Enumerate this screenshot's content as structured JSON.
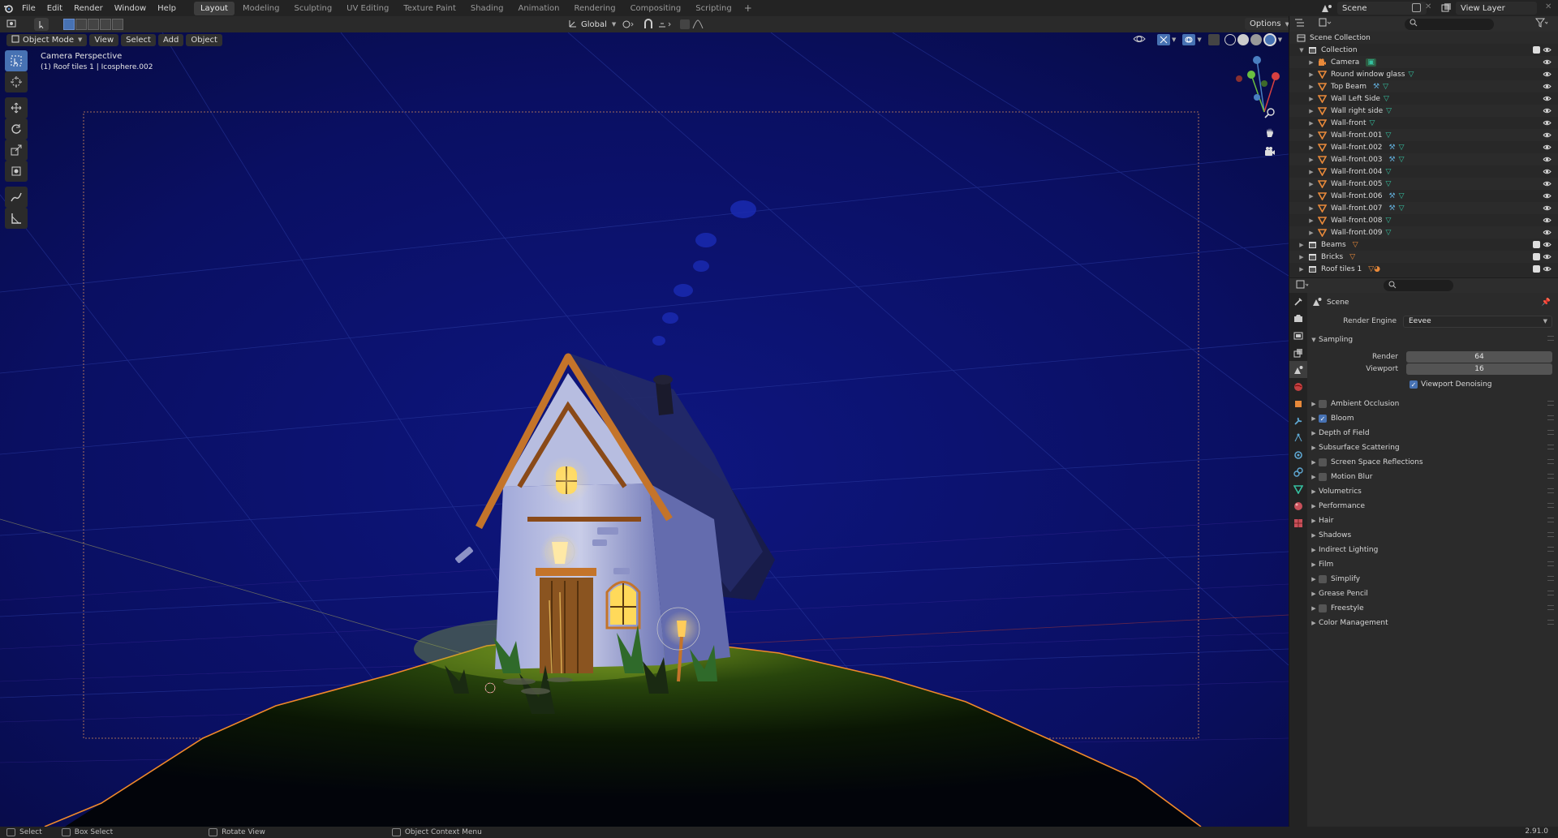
{
  "topbar": {
    "menus": [
      "File",
      "Edit",
      "Render",
      "Window",
      "Help"
    ],
    "workspaces": [
      "Layout",
      "Modeling",
      "Sculpting",
      "UV Editing",
      "Texture Paint",
      "Shading",
      "Animation",
      "Rendering",
      "Compositing",
      "Scripting"
    ],
    "active_workspace": "Layout",
    "add_tab": "+",
    "scene": "Scene",
    "view_layer": "View Layer"
  },
  "viewport_header": {
    "mode": "Object Mode",
    "menus": [
      "View",
      "Select",
      "Add",
      "Object"
    ],
    "orientation": "Global",
    "options": "Options"
  },
  "viewport": {
    "camera_label": "Camera Perspective",
    "object_label": "(1) Roof tiles 1 | Icosphere.002"
  },
  "tools": [
    "select-box",
    "cursor",
    "move",
    "rotate",
    "scale",
    "transform",
    "annotate",
    "measure"
  ],
  "outliner": {
    "root": "Scene Collection",
    "collection": "Collection",
    "objects": [
      {
        "name": "Camera",
        "icon": "camera-icon"
      },
      {
        "name": "Round window glass",
        "icon": "mesh-object-icon"
      },
      {
        "name": "Top Beam",
        "icon": "mesh-object-icon"
      },
      {
        "name": "Wall Left Side",
        "icon": "mesh-object-icon"
      },
      {
        "name": "Wall right side",
        "icon": "mesh-object-icon"
      },
      {
        "name": "Wall-front",
        "icon": "mesh-object-icon"
      },
      {
        "name": "Wall-front.001",
        "icon": "mesh-object-icon"
      },
      {
        "name": "Wall-front.002",
        "icon": "mesh-object-icon"
      },
      {
        "name": "Wall-front.003",
        "icon": "mesh-object-icon"
      },
      {
        "name": "Wall-front.004",
        "icon": "mesh-object-icon"
      },
      {
        "name": "Wall-front.005",
        "icon": "mesh-object-icon"
      },
      {
        "name": "Wall-front.006",
        "icon": "mesh-object-icon"
      },
      {
        "name": "Wall-front.007",
        "icon": "mesh-object-icon"
      },
      {
        "name": "Wall-front.008",
        "icon": "mesh-object-icon"
      },
      {
        "name": "Wall-front.009",
        "icon": "mesh-object-icon"
      }
    ],
    "collections": [
      "Beams",
      "Bricks",
      "Roof tiles 1"
    ]
  },
  "properties": {
    "context": "Scene",
    "render_engine_label": "Render Engine",
    "render_engine": "Eevee",
    "sampling": {
      "title": "Sampling",
      "render_label": "Render",
      "render_value": "64",
      "viewport_label": "Viewport",
      "viewport_value": "16",
      "denoise_label": "Viewport Denoising"
    },
    "panels": [
      {
        "name": "Ambient Occlusion",
        "checkbox": true,
        "checked": false
      },
      {
        "name": "Bloom",
        "checkbox": true,
        "checked": true
      },
      {
        "name": "Depth of Field",
        "checkbox": false,
        "checked": false
      },
      {
        "name": "Subsurface Scattering",
        "checkbox": false,
        "checked": false
      },
      {
        "name": "Screen Space Reflections",
        "checkbox": true,
        "checked": false
      },
      {
        "name": "Motion Blur",
        "checkbox": true,
        "checked": false
      },
      {
        "name": "Volumetrics",
        "checkbox": false,
        "checked": false
      },
      {
        "name": "Performance",
        "checkbox": false,
        "checked": false
      },
      {
        "name": "Hair",
        "checkbox": false,
        "checked": false
      },
      {
        "name": "Shadows",
        "checkbox": false,
        "checked": false
      },
      {
        "name": "Indirect Lighting",
        "checkbox": false,
        "checked": false
      },
      {
        "name": "Film",
        "checkbox": false,
        "checked": false
      },
      {
        "name": "Simplify",
        "checkbox": true,
        "checked": false
      },
      {
        "name": "Grease Pencil",
        "checkbox": false,
        "checked": false
      },
      {
        "name": "Freestyle",
        "checkbox": true,
        "checked": false
      },
      {
        "name": "Color Management",
        "checkbox": false,
        "checked": false
      }
    ]
  },
  "statusbar": {
    "items": [
      "Select",
      "Box Select",
      "Rotate View",
      "Object Context Menu"
    ],
    "version": "2.91.0"
  },
  "colors": {
    "accent": "#4772b3",
    "object_orange": "#e8893a",
    "mesh_green": "#35c0a0",
    "viewport_bg": "#0a0f5a"
  }
}
